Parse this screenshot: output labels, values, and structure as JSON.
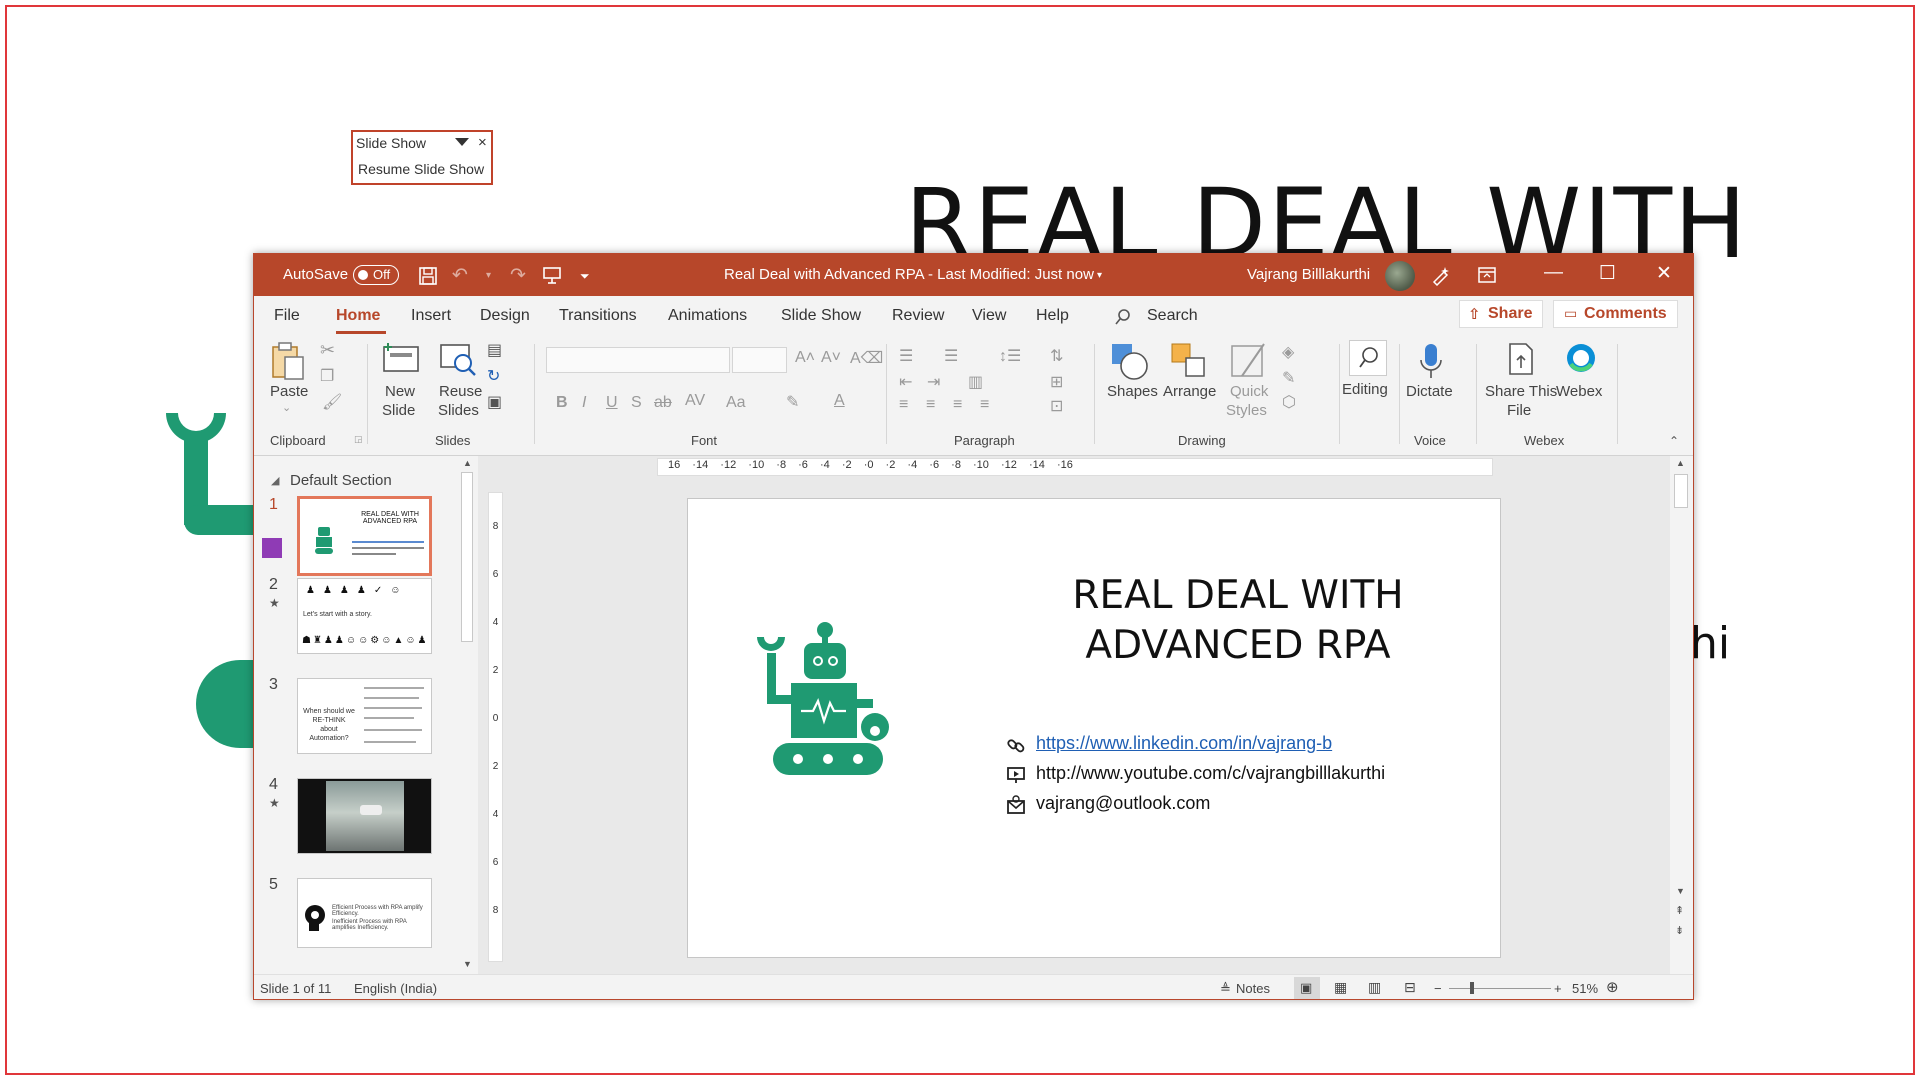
{
  "background": {
    "title_fragment": "REAL DEAL WITH",
    "right_fragment": "hi"
  },
  "slideshow_box": {
    "title": "Slide Show",
    "resume": "Resume Slide Show",
    "close": "×"
  },
  "titlebar": {
    "autosave_label": "AutoSave",
    "autosave_state": "Off",
    "doc_title": "Real Deal with Advanced RPA  -  Last Modified: Just now",
    "search": "Search",
    "user": "Vajrang Billlakurthi"
  },
  "tabs": [
    "File",
    "Home",
    "Insert",
    "Design",
    "Transitions",
    "Animations",
    "Slide Show",
    "Review",
    "View",
    "Help"
  ],
  "share_label": "Share",
  "comments_label": "Comments",
  "ribbon": {
    "paste": "Paste",
    "clipboard": "Clipboard",
    "new_slide_1": "New",
    "new_slide_2": "Slide",
    "reuse_1": "Reuse",
    "reuse_2": "Slides",
    "slides": "Slides",
    "font": "Font",
    "paragraph": "Paragraph",
    "shapes": "Shapes",
    "arrange": "Arrange",
    "quick_1": "Quick",
    "quick_2": "Styles",
    "drawing": "Drawing",
    "editing": "Editing",
    "dictate": "Dictate",
    "voice": "Voice",
    "share_file_1": "Share This",
    "share_file_2": "File",
    "webex": "Webex",
    "webex_group": "Webex"
  },
  "slides_panel": {
    "section": "Default Section",
    "numbers": [
      "1",
      "2",
      "3",
      "4",
      "5"
    ],
    "thumb1_title": "REAL DEAL WITH ADVANCED RPA",
    "thumb2_text": "Let's start with a story.",
    "thumb3_text": "When should we RE-THINK about Automation?",
    "thumb5_line1": "Efficient Process with RPA amplify Efficiency.",
    "thumb5_line2": "Inefficient Process with RPA amplifies Inefficiency."
  },
  "ruler": {
    "h_labels": [
      "16",
      "14",
      "12",
      "10",
      "8",
      "6",
      "4",
      "2",
      "0",
      "2",
      "4",
      "6",
      "8",
      "10",
      "12",
      "14",
      "16"
    ],
    "v_labels": [
      "8",
      "6",
      "4",
      "2",
      "0",
      "2",
      "4",
      "6",
      "8"
    ]
  },
  "slide": {
    "title_line1": "REAL DEAL WITH",
    "title_line2": "ADVANCED RPA",
    "linkedin": "https://www.linkedin.com/in/vajrang-b",
    "youtube": "http://www.youtube.com/c/vajrangbilllakurthi",
    "email": "vajrang@outlook.com"
  },
  "status": {
    "slide_of": "Slide 1 of 11",
    "language": "English (India)",
    "notes": "Notes",
    "zoom": "51%"
  },
  "colors": {
    "accent": "#b7472a",
    "robot": "#1f9a72",
    "link": "#1f5fb4"
  }
}
